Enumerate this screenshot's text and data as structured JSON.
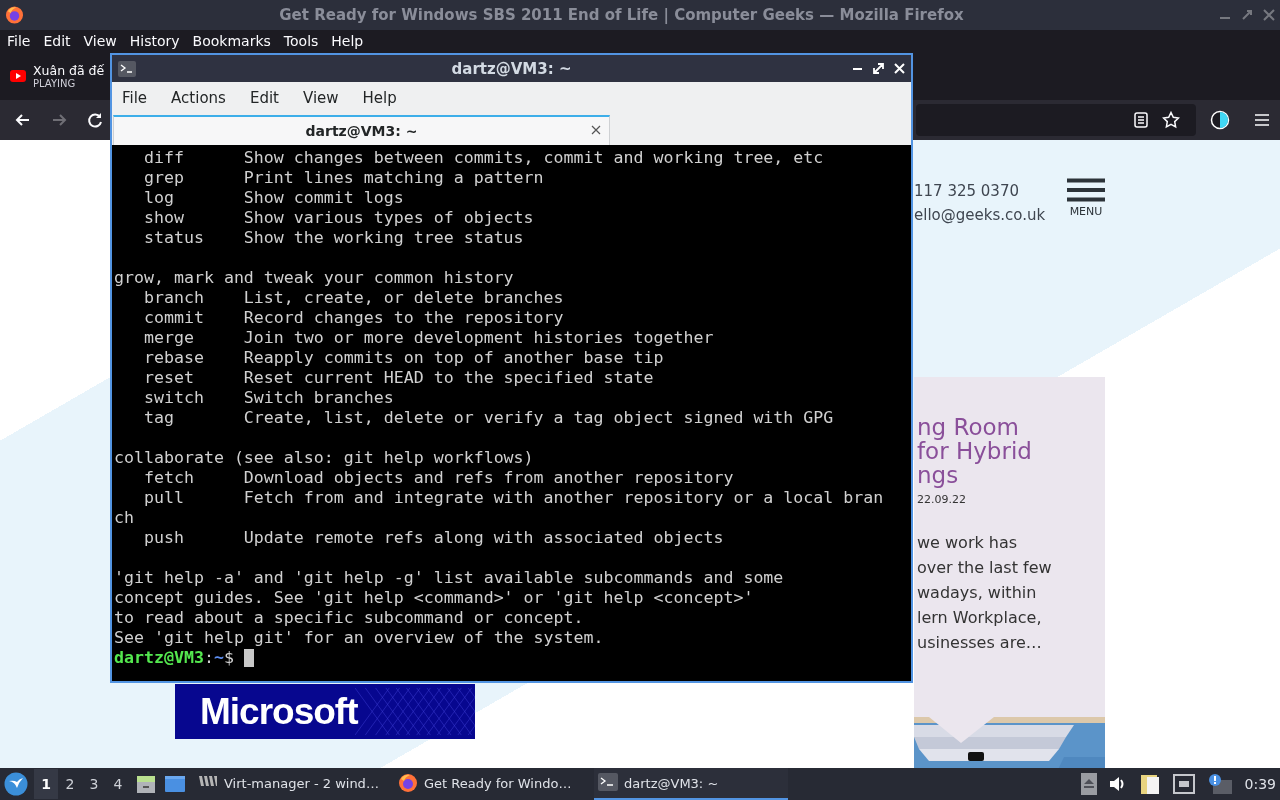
{
  "browser": {
    "title": "Get Ready for Windows SBS 2011 End of Life | Computer Geeks — Mozilla Firefox",
    "menu": [
      "File",
      "Edit",
      "View",
      "History",
      "Bookmarks",
      "Tools",
      "Help"
    ],
    "tab": {
      "title": "Xuân đã đế",
      "status": "PLAYING"
    },
    "nav_buttons": [
      {
        "kind": "back",
        "disabled": false
      },
      {
        "kind": "forward",
        "disabled": true
      },
      {
        "kind": "reload",
        "disabled": false
      }
    ],
    "page": {
      "phone": "117 325 0370",
      "email": "ello@geeks.co.uk",
      "menu_label": "MENU",
      "card": {
        "title_lines": [
          "ng Room",
          "for Hybrid",
          "ngs"
        ],
        "date": "22.09.22",
        "excerpt_lines": [
          "we work has",
          "over the last few",
          "wadays, within",
          "lern Workplace,",
          "usinesses are…"
        ],
        "image": {
          "kind": "picture"
        }
      },
      "banner": {
        "text": "Microsoft"
      }
    }
  },
  "terminal": {
    "title": "dartz@VM3: ~",
    "menu": [
      "File",
      "Actions",
      "Edit",
      "View",
      "Help"
    ],
    "tabs": [
      {
        "label": "dartz@VM3: ~",
        "selected": true
      }
    ],
    "blocks": [
      [
        "   diff      Show changes between commits, commit and working tree, etc",
        "   grep      Print lines matching a pattern",
        "   log       Show commit logs",
        "   show      Show various types of objects",
        "   status    Show the working tree status"
      ],
      [
        "grow, mark and tweak your common history",
        "   branch    List, create, or delete branches",
        "   commit    Record changes to the repository",
        "   merge     Join two or more development histories together",
        "   rebase    Reapply commits on top of another base tip",
        "   reset     Reset current HEAD to the specified state",
        "   switch    Switch branches",
        "   tag       Create, list, delete or verify a tag object signed with GPG"
      ],
      [
        "collaborate (see also: git help workflows)",
        "   fetch     Download objects and refs from another repository",
        "   pull      Fetch from and integrate with another repository or a local bran",
        "ch",
        "   push      Update remote refs along with associated objects"
      ],
      [
        "'git help -a' and 'git help -g' list available subcommands and some",
        "concept guides. See 'git help <command>' or 'git help <concept>'",
        "to read about a specific subcommand or concept.",
        "See 'git help git' for an overview of the system."
      ]
    ],
    "prompt": {
      "user_host": "dartz@VM3",
      "separator": ":",
      "path": "~",
      "symbol": "$"
    }
  },
  "taskbar": {
    "workspaces": [
      {
        "label": "1",
        "selected": true
      },
      {
        "label": "2",
        "selected": false
      },
      {
        "label": "3",
        "selected": false
      },
      {
        "label": "4",
        "selected": false
      }
    ],
    "tasks": [
      {
        "kind": "virt",
        "label": "Virt-manager - 2 wind…",
        "selected": false
      },
      {
        "kind": "firefox",
        "label": "Get Ready for Windo…",
        "selected": false
      },
      {
        "kind": "terminal",
        "label": "dartz@VM3: ~",
        "selected": true
      }
    ],
    "clock": "0:39"
  }
}
